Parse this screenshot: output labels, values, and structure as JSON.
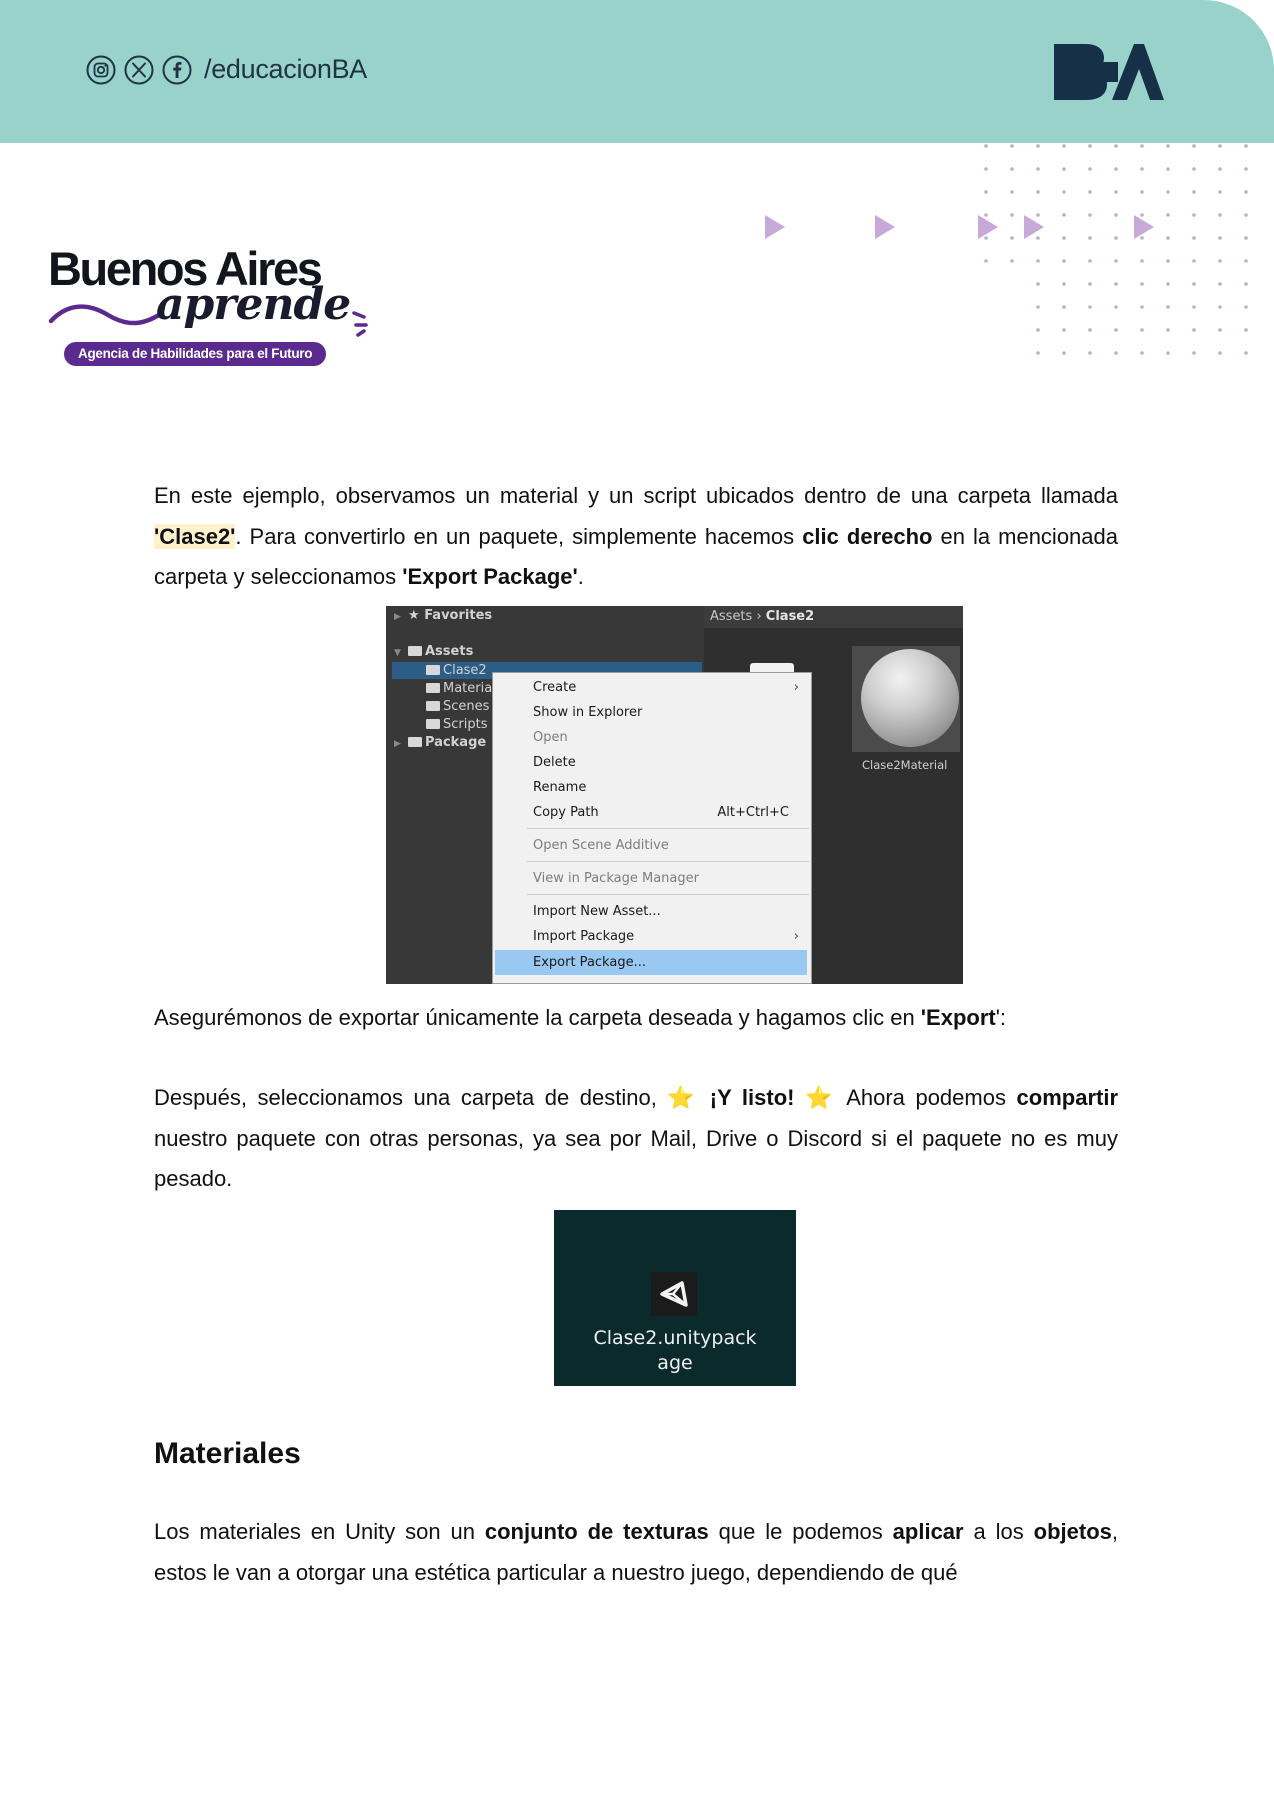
{
  "header": {
    "handle": "/educacionBA",
    "social_icons": [
      "instagram-icon",
      "x-icon",
      "facebook-icon"
    ],
    "city_logo": "BA",
    "band_color": "#98d2cb"
  },
  "brand": {
    "title": "Buenos Aires",
    "script": "aprende",
    "tagline": "Agencia de Habilidades para el Futuro",
    "accent": "#5a2a8e"
  },
  "content": {
    "p1": [
      {
        "t": "En este ejemplo, observamos un material y un script ubicados dentro de una carpeta llamada "
      },
      {
        "t": "'Clase2'",
        "s": "hl"
      },
      {
        "t": ". Para convertirlo en un paquete, simplemente hacemos "
      },
      {
        "t": "clic derecho",
        "s": "b"
      },
      {
        "t": " en la mencionada carpeta y seleccionamos "
      },
      {
        "t": "'Export Package'",
        "s": "b"
      },
      {
        "t": "."
      }
    ],
    "p2": [
      {
        "t": "Asegurémonos de exportar únicamente la carpeta deseada y hagamos clic en "
      },
      {
        "t": "'Export",
        "s": "b"
      },
      {
        "t": "':"
      }
    ],
    "p3": [
      {
        "t": "Después, seleccionamos una carpeta de destino,  ⭐ "
      },
      {
        "t": "¡Y listo!",
        "s": "b"
      },
      {
        "t": " ⭐ Ahora podemos "
      },
      {
        "t": "compartir",
        "s": "b"
      },
      {
        "t": " nuestro paquete con otras personas, ya sea por Mail, Drive o Discord si el paquete no es muy pesado."
      }
    ],
    "heading": "Materiales",
    "p4": [
      {
        "t": "Los materiales en Unity son un "
      },
      {
        "t": "conjunto de texturas",
        "s": "b"
      },
      {
        "t": " que le podemos "
      },
      {
        "t": "aplicar",
        "s": "b"
      },
      {
        "t": " a los "
      },
      {
        "t": "objetos",
        "s": "b"
      },
      {
        "t": ", estos le van a otorgar una estética particular a nuestro juego, dependiendo de qué"
      }
    ]
  },
  "unity": {
    "favorites": "Favorites",
    "assets": "Assets",
    "folders": [
      "Clase2",
      "Materia",
      "Scenes",
      "Scripts"
    ],
    "packages": "Package",
    "breadcrumb_root": "Assets",
    "breadcrumb_current": "Clase2",
    "material_label": "Clase2Material",
    "menu": {
      "create": "Create",
      "show_in_explorer": "Show in Explorer",
      "open": "Open",
      "delete": "Delete",
      "rename": "Rename",
      "copy_path": "Copy Path",
      "copy_path_shortcut": "Alt+Ctrl+C",
      "open_scene_additive": "Open Scene Additive",
      "view_in_package_manager": "View in Package Manager",
      "import_new_asset": "Import New Asset...",
      "import_package": "Import Package",
      "export_package": "Export Package..."
    }
  },
  "package_file": {
    "line1": "Clase2.unitypack",
    "line2": "age"
  }
}
